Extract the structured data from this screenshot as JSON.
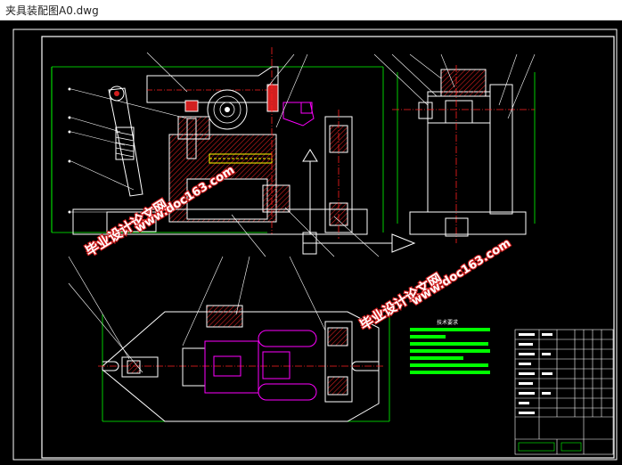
{
  "window": {
    "title": "夹具装配图A0.dwg"
  },
  "drawing": {
    "tech_requirements_title": "技术要求",
    "watermarks": [
      {
        "text": "毕业设计论文网"
      },
      {
        "text": "www.doc163.com"
      },
      {
        "text": "毕业设计论文网"
      },
      {
        "text": "www.doc163.com"
      }
    ],
    "colors": {
      "background": "#000000",
      "frame": "#ffffff",
      "red_part": "#d21f1f",
      "hatch": "#d21f1f",
      "centerline": "#ff2020",
      "green_dim": "#00ff00",
      "magenta": "#ff00ff",
      "yellow": "#ffff00",
      "cyan": "#00ffff"
    }
  }
}
